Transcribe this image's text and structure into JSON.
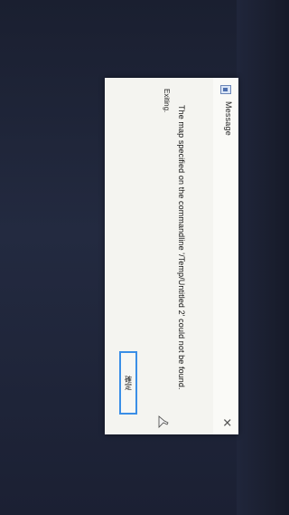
{
  "dialog": {
    "title": "Message",
    "message": "The map specified on the commandline '/Temp/Untitled 2' could not be found.",
    "status": "Exiting.",
    "ok_label": "確定",
    "close_symbol": "✕"
  },
  "icons": {
    "title_icon": "window-icon",
    "close_icon": "close-icon",
    "cursor": "mouse-cursor-icon"
  },
  "colors": {
    "accent": "#3a8ee6",
    "dialog_bg": "#f4f4f0"
  }
}
